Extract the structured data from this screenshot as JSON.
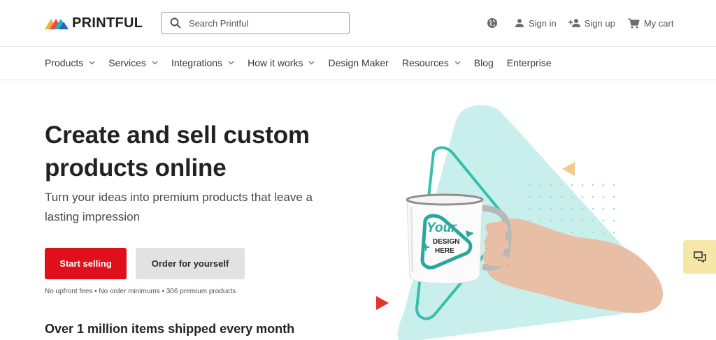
{
  "header": {
    "logo_text": "PRINTFUL",
    "search_placeholder": "Search Printful",
    "sign_in": "Sign in",
    "sign_up": "Sign up",
    "cart": "My cart"
  },
  "nav": {
    "items": [
      {
        "label": "Products",
        "has_dropdown": true
      },
      {
        "label": "Services",
        "has_dropdown": true
      },
      {
        "label": "Integrations",
        "has_dropdown": true
      },
      {
        "label": "How it works",
        "has_dropdown": true
      },
      {
        "label": "Design Maker",
        "has_dropdown": false
      },
      {
        "label": "Resources",
        "has_dropdown": true
      },
      {
        "label": "Blog",
        "has_dropdown": false
      },
      {
        "label": "Enterprise",
        "has_dropdown": false
      }
    ]
  },
  "hero": {
    "title": "Create and sell custom products online",
    "subtitle": "Turn your ideas into premium products that leave a lasting impression",
    "primary_button": "Start selling",
    "secondary_button": "Order for yourself",
    "fineprint": "No upfront fees • No order minimums • 306 premium products",
    "shipped": "Over 1 million items shipped every month"
  },
  "mug": {
    "line1": "Your",
    "line2": "DESIGN",
    "line3": "HERE"
  },
  "colors": {
    "primary": "#e00f1b",
    "secondary_button": "#e2e2e2",
    "teal": "#34bfae",
    "teal_light": "#c9efec",
    "chat_bg": "#f6e7a8"
  }
}
